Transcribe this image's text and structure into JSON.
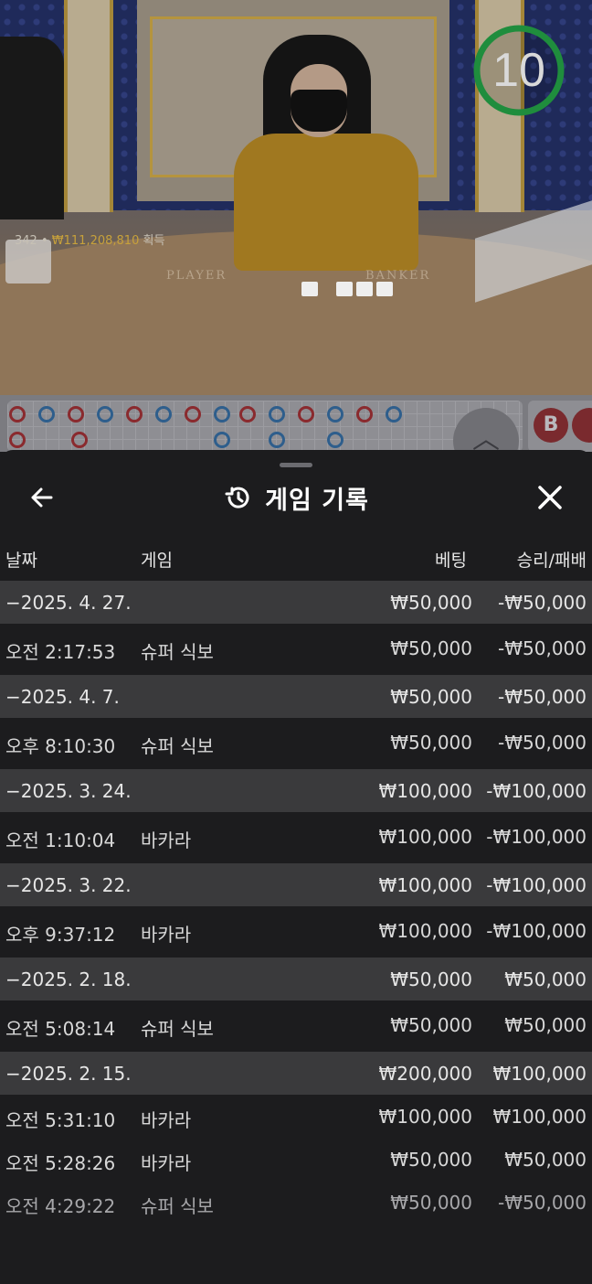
{
  "live": {
    "countdown": "10",
    "winner_count": "342",
    "winner_amount": "₩111,208,810",
    "winner_suffix": "획득",
    "table_player_word": "PLAYER",
    "table_banker_word": "BANKER"
  },
  "road": {
    "scroll_up_glyph": "︿",
    "side_bead_label": "B"
  },
  "history": {
    "title": "게임 기록",
    "back_glyph": "←",
    "close_glyph": "✕",
    "columns": {
      "date": "날짜",
      "game": "게임",
      "bet": "베팅",
      "result": "승리/패배"
    },
    "rows": [
      {
        "kind": "date",
        "c1": "−2025. 4. 27.",
        "c2": "",
        "c3": "₩50,000",
        "c4": "-₩50,000"
      },
      {
        "kind": "tx",
        "c1": "오전 2:17:53",
        "c2": "슈퍼 식보",
        "c3": "₩50,000",
        "c4": "-₩50,000"
      },
      {
        "kind": "date",
        "c1": "−2025. 4. 7.",
        "c2": "",
        "c3": "₩50,000",
        "c4": "-₩50,000"
      },
      {
        "kind": "tx",
        "c1": "오후 8:10:30",
        "c2": "슈퍼 식보",
        "c3": "₩50,000",
        "c4": "-₩50,000"
      },
      {
        "kind": "date",
        "c1": "−2025. 3. 24.",
        "c2": "",
        "c3": "₩100,000",
        "c4": "-₩100,000"
      },
      {
        "kind": "tx",
        "c1": "오전 1:10:04",
        "c2": "바카라",
        "c3": "₩100,000",
        "c4": "-₩100,000"
      },
      {
        "kind": "date",
        "c1": "−2025. 3. 22.",
        "c2": "",
        "c3": "₩100,000",
        "c4": "-₩100,000"
      },
      {
        "kind": "tx",
        "c1": "오후 9:37:12",
        "c2": "바카라",
        "c3": "₩100,000",
        "c4": "-₩100,000"
      },
      {
        "kind": "date",
        "c1": "−2025. 2. 18.",
        "c2": "",
        "c3": "₩50,000",
        "c4": "₩50,000"
      },
      {
        "kind": "tx",
        "c1": "오전 5:08:14",
        "c2": "슈퍼 식보",
        "c3": "₩50,000",
        "c4": "₩50,000"
      },
      {
        "kind": "date",
        "c1": "−2025. 2. 15.",
        "c2": "",
        "c3": "₩200,000",
        "c4": "₩100,000"
      },
      {
        "kind": "tx",
        "c1": "오전 5:31:10",
        "c2": "바카라",
        "c3": "₩100,000",
        "c4": "₩100,000"
      },
      {
        "kind": "tx",
        "c1": "오전 5:28:26",
        "c2": "바카라",
        "c3": "₩50,000",
        "c4": "₩50,000"
      },
      {
        "kind": "tx",
        "c1": "오전 4:29:22",
        "c2": "슈퍼 식보",
        "c3": "₩50,000",
        "c4": "-₩50,000"
      }
    ]
  }
}
